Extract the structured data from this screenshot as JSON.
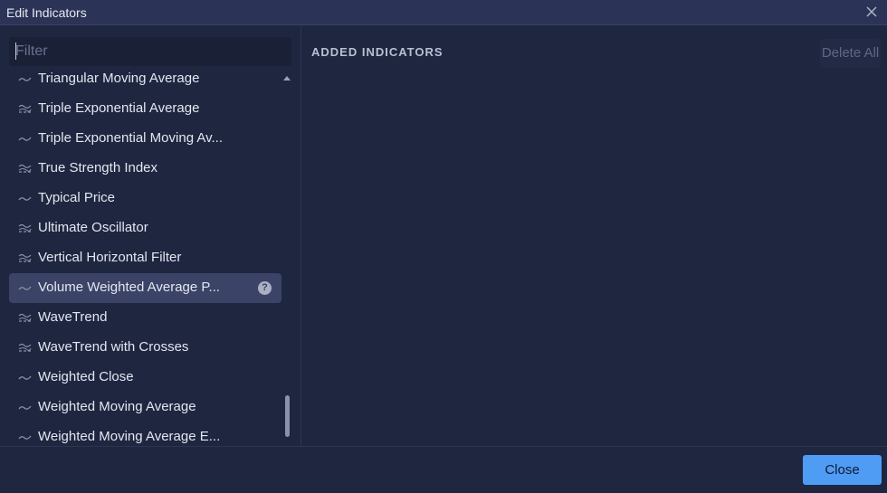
{
  "window": {
    "title": "Edit Indicators"
  },
  "filter": {
    "placeholder": "Filter"
  },
  "indicators": [
    {
      "label": "Triangular Moving Average",
      "icon": "single-line-icon"
    },
    {
      "label": "Triple Exponential Average",
      "icon": "double-line-icon"
    },
    {
      "label": "Triple Exponential Moving Av...",
      "icon": "single-line-icon"
    },
    {
      "label": "True Strength Index",
      "icon": "double-line-icon"
    },
    {
      "label": "Typical Price",
      "icon": "single-line-icon"
    },
    {
      "label": "Ultimate Oscillator",
      "icon": "double-line-icon"
    },
    {
      "label": "Vertical Horizontal Filter",
      "icon": "double-line-icon"
    },
    {
      "label": "Volume Weighted Average P...",
      "icon": "single-line-icon",
      "selected": true,
      "help": "?"
    },
    {
      "label": "WaveTrend",
      "icon": "double-line-icon"
    },
    {
      "label": "WaveTrend with Crosses",
      "icon": "double-line-icon"
    },
    {
      "label": "Weighted Close",
      "icon": "single-line-icon"
    },
    {
      "label": "Weighted Moving Average",
      "icon": "single-line-icon"
    },
    {
      "label": "Weighted Moving Average E...",
      "icon": "single-line-icon"
    }
  ],
  "added": {
    "heading": "ADDED INDICATORS",
    "delete_all_label": "Delete All"
  },
  "footer": {
    "close_label": "Close"
  },
  "colors": {
    "background": "#1f2640",
    "titlebar": "#2b3356",
    "selected_row": "#3b4366",
    "primary_button": "#4f9cf5"
  }
}
